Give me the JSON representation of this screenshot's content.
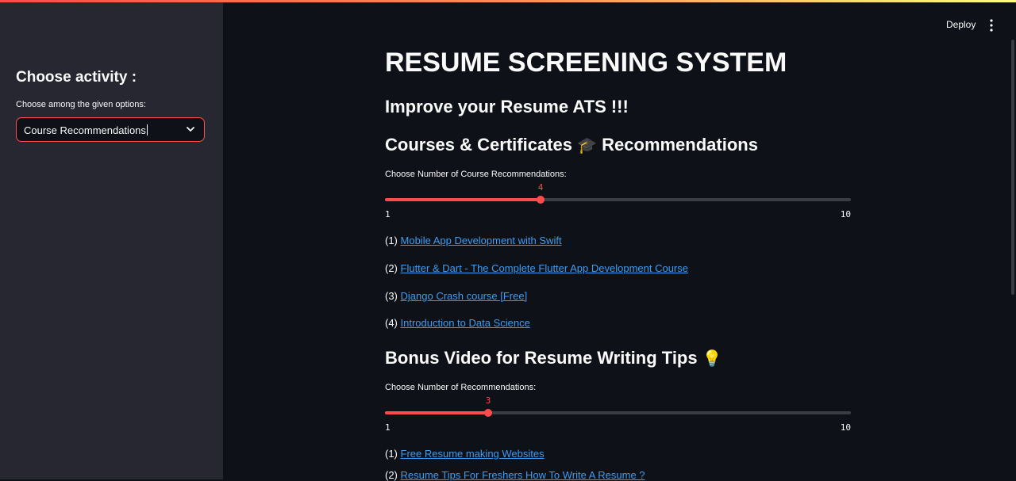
{
  "sidebar": {
    "heading": "Choose activity :",
    "select_label": "Choose among the given options:",
    "select_value": "Course Recommendations"
  },
  "header": {
    "deploy_label": "Deploy"
  },
  "main": {
    "title": "RESUME SCREENING SYSTEM",
    "subtitle": "Improve your Resume ATS !!!",
    "courses_heading": "Courses & Certificates",
    "courses_heading_emoji": "🎓",
    "courses_heading_suffix": "Recommendations",
    "course_slider": {
      "label": "Choose Number of Course Recommendations:",
      "value": 4,
      "min": 1,
      "max": 10
    },
    "courses": [
      {
        "num": "(1)",
        "title": "Mobile App Development with Swift"
      },
      {
        "num": "(2)",
        "title": "Flutter & Dart - The Complete Flutter App Development Course"
      },
      {
        "num": "(3)",
        "title": "Django Crash course [Free]"
      },
      {
        "num": "(4)",
        "title": "Introduction to Data Science"
      }
    ],
    "video_heading": "Bonus Video for Resume Writing Tips",
    "video_heading_emoji": "💡",
    "video_slider": {
      "label": "Choose Number of Recommendations:",
      "value": 3,
      "min": 1,
      "max": 10
    },
    "videos": [
      {
        "num": "(1)",
        "title": "Free Resume making Websites"
      },
      {
        "num": "(2)",
        "title": "Resume Tips For Freshers How To Write A Resume ?"
      }
    ]
  },
  "colors": {
    "accent": "#ff4b4b",
    "link": "#3d9df3",
    "bg": "#0e1117",
    "sidebar": "#262730"
  }
}
